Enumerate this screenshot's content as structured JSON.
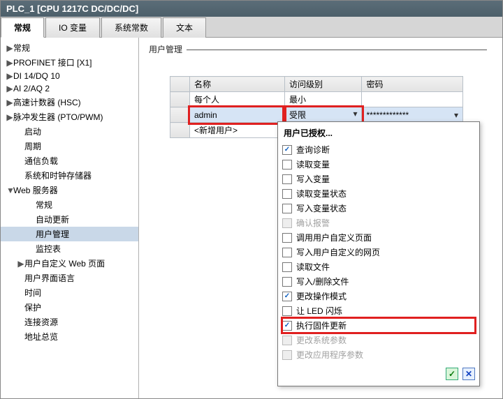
{
  "title": "PLC_1 [CPU 1217C DC/DC/DC]",
  "tabs": [
    {
      "label": "常规",
      "active": true
    },
    {
      "label": "IO 变量",
      "active": false
    },
    {
      "label": "系统常数",
      "active": false
    },
    {
      "label": "文本",
      "active": false
    }
  ],
  "tree": [
    {
      "label": "常规",
      "arrow": "▶",
      "indent": 0
    },
    {
      "label": "PROFINET 接口 [X1]",
      "arrow": "▶",
      "indent": 0
    },
    {
      "label": "DI 14/DQ 10",
      "arrow": "▶",
      "indent": 0
    },
    {
      "label": "AI 2/AQ 2",
      "arrow": "▶",
      "indent": 0
    },
    {
      "label": "高速计数器 (HSC)",
      "arrow": "▶",
      "indent": 0
    },
    {
      "label": "脉冲发生器 (PTO/PWM)",
      "arrow": "▶",
      "indent": 0
    },
    {
      "label": "启动",
      "arrow": "",
      "indent": 1
    },
    {
      "label": "周期",
      "arrow": "",
      "indent": 1
    },
    {
      "label": "通信负载",
      "arrow": "",
      "indent": 1
    },
    {
      "label": "系统和时钟存储器",
      "arrow": "",
      "indent": 1
    },
    {
      "label": "Web 服务器",
      "arrow": "▼",
      "indent": 0
    },
    {
      "label": "常规",
      "arrow": "",
      "indent": 2
    },
    {
      "label": "自动更新",
      "arrow": "",
      "indent": 2
    },
    {
      "label": "用户管理",
      "arrow": "",
      "indent": 2,
      "selected": true
    },
    {
      "label": "监控表",
      "arrow": "",
      "indent": 2
    },
    {
      "label": "用户自定义 Web 页面",
      "arrow": "▶",
      "indent": 1
    },
    {
      "label": "用户界面语言",
      "arrow": "",
      "indent": 1
    },
    {
      "label": "时间",
      "arrow": "",
      "indent": 1
    },
    {
      "label": "保护",
      "arrow": "",
      "indent": 1
    },
    {
      "label": "连接资源",
      "arrow": "",
      "indent": 1
    },
    {
      "label": "地址总览",
      "arrow": "",
      "indent": 1
    }
  ],
  "section_title": "用户管理",
  "user_table": {
    "headers": {
      "name": "名称",
      "access": "访问级别",
      "password": "密码"
    },
    "rows": [
      {
        "name": "每个人",
        "access": "最小",
        "password": ""
      },
      {
        "name": "admin",
        "access": "受限",
        "password": "*************",
        "highlight": true
      },
      {
        "name": "<新增用户>",
        "access": "",
        "password": ""
      }
    ]
  },
  "permissions_panel": {
    "title": "用户已授权...",
    "items": [
      {
        "label": "查询诊断",
        "checked": true,
        "disabled": false
      },
      {
        "label": "读取变量",
        "checked": false,
        "disabled": false
      },
      {
        "label": "写入变量",
        "checked": false,
        "disabled": false
      },
      {
        "label": "读取变量状态",
        "checked": false,
        "disabled": false
      },
      {
        "label": "写入变量状态",
        "checked": false,
        "disabled": false
      },
      {
        "label": "确认报警",
        "checked": false,
        "disabled": true
      },
      {
        "label": "调用用户自定义页面",
        "checked": false,
        "disabled": false
      },
      {
        "label": "写入用户自定义的网页",
        "checked": false,
        "disabled": false
      },
      {
        "label": "读取文件",
        "checked": false,
        "disabled": false
      },
      {
        "label": "写入/删除文件",
        "checked": false,
        "disabled": false
      },
      {
        "label": "更改操作模式",
        "checked": true,
        "disabled": false
      },
      {
        "label": "让 LED 闪烁",
        "checked": false,
        "disabled": false
      },
      {
        "label": "执行固件更新",
        "checked": true,
        "disabled": false,
        "highlight": true
      },
      {
        "label": "更改系统参数",
        "checked": false,
        "disabled": true
      },
      {
        "label": "更改应用程序参数",
        "checked": false,
        "disabled": true
      }
    ],
    "ok_glyph": "✓",
    "cancel_glyph": "✕"
  }
}
